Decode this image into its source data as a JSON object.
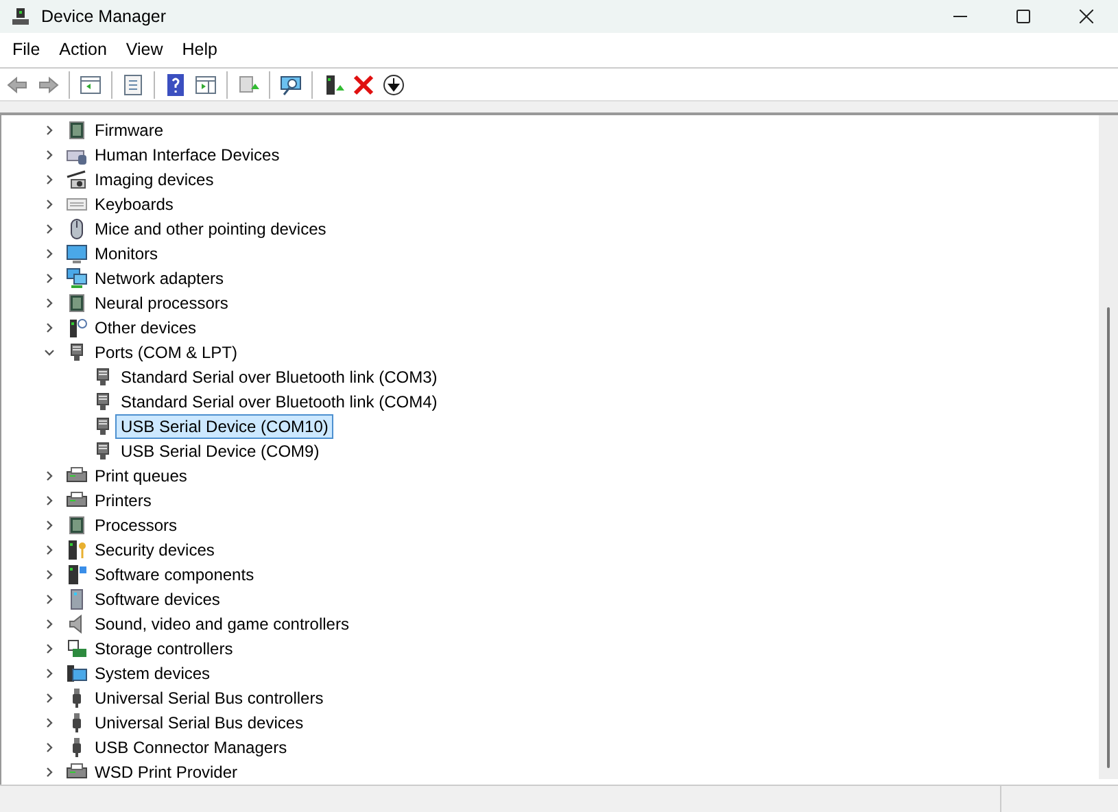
{
  "window": {
    "title": "Device Manager"
  },
  "menu": [
    {
      "label": "File"
    },
    {
      "label": "Action"
    },
    {
      "label": "View"
    },
    {
      "label": "Help"
    }
  ],
  "tree": [
    {
      "label": "Firmware",
      "expanded": false,
      "selected": false
    },
    {
      "label": "Human Interface Devices",
      "expanded": false,
      "selected": false
    },
    {
      "label": "Imaging devices",
      "expanded": false,
      "selected": false
    },
    {
      "label": "Keyboards",
      "expanded": false,
      "selected": false
    },
    {
      "label": "Mice and other pointing devices",
      "expanded": false,
      "selected": false
    },
    {
      "label": "Monitors",
      "expanded": false,
      "selected": false
    },
    {
      "label": "Network adapters",
      "expanded": false,
      "selected": false
    },
    {
      "label": "Neural processors",
      "expanded": false,
      "selected": false
    },
    {
      "label": "Other devices",
      "expanded": false,
      "selected": false
    },
    {
      "label": "Ports (COM & LPT)",
      "expanded": true,
      "selected": false,
      "children": [
        {
          "label": "Standard Serial over Bluetooth link (COM3)",
          "selected": false
        },
        {
          "label": "Standard Serial over Bluetooth link (COM4)",
          "selected": false
        },
        {
          "label": "USB Serial Device (COM10)",
          "selected": true
        },
        {
          "label": "USB Serial Device (COM9)",
          "selected": false
        }
      ]
    },
    {
      "label": "Print queues",
      "expanded": false,
      "selected": false
    },
    {
      "label": "Printers",
      "expanded": false,
      "selected": false
    },
    {
      "label": "Processors",
      "expanded": false,
      "selected": false
    },
    {
      "label": "Security devices",
      "expanded": false,
      "selected": false
    },
    {
      "label": "Software components",
      "expanded": false,
      "selected": false
    },
    {
      "label": "Software devices",
      "expanded": false,
      "selected": false
    },
    {
      "label": "Sound, video and game controllers",
      "expanded": false,
      "selected": false
    },
    {
      "label": "Storage controllers",
      "expanded": false,
      "selected": false
    },
    {
      "label": "System devices",
      "expanded": false,
      "selected": false
    },
    {
      "label": "Universal Serial Bus controllers",
      "expanded": false,
      "selected": false
    },
    {
      "label": "Universal Serial Bus devices",
      "expanded": false,
      "selected": false
    },
    {
      "label": "USB Connector Managers",
      "expanded": false,
      "selected": false
    },
    {
      "label": "WSD Print Provider",
      "expanded": false,
      "selected": false
    }
  ]
}
